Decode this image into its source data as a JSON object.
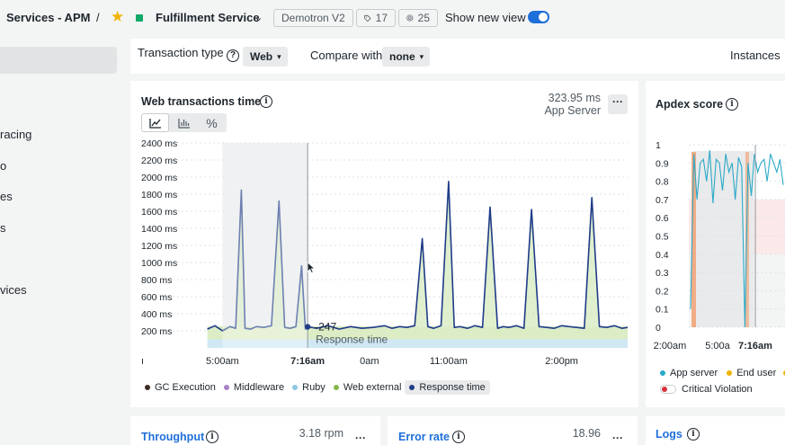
{
  "header": {
    "breadcrumb": "Services - APM",
    "separator": "/",
    "entity_name": "Fulfillment Service",
    "environment_tag": "Demotron V2",
    "tags_count": "17",
    "related_count": "25",
    "toggle_label": "Show new view",
    "toggle_on": true,
    "colors": {
      "favorite": "#f0b400",
      "health": "#11a968",
      "toggle": "#1e6fd9"
    }
  },
  "sidebar": {
    "items": [
      {
        "label": "racing"
      },
      {
        "label": "o"
      },
      {
        "label": "es"
      },
      {
        "label": "s"
      },
      {
        "label": "vices"
      }
    ]
  },
  "filters": {
    "transaction_type_label": "Transaction type",
    "transaction_type_value": "Web",
    "compare_label": "Compare with",
    "compare_value": "none",
    "instances_label": "Instances"
  },
  "web_transactions": {
    "title": "Web transactions time",
    "summary_value": "323.95 ms",
    "summary_label": "App Server",
    "tooltip_value": "247",
    "tooltip_label": "Response time",
    "legend": [
      {
        "label": "GC Execution",
        "color": "#3b2b22"
      },
      {
        "label": "Middleware",
        "color": "#a783c6"
      },
      {
        "label": "Ruby",
        "color": "#8ec6e6"
      },
      {
        "label": "Web external",
        "color": "#86b84a"
      },
      {
        "label": "Response time",
        "color": "#1f3c88"
      }
    ]
  },
  "apdex": {
    "title": "Apdex score",
    "legend": [
      {
        "label": "App server",
        "color": "#2aa9c9"
      },
      {
        "label": "End user",
        "color": "#f0b400"
      }
    ],
    "critical_label": "Critical Violation",
    "colors": {
      "critical": "#d8313a"
    }
  },
  "throughput": {
    "title": "Throughput",
    "value": "3.18",
    "unit": "rpm"
  },
  "error_rate": {
    "title": "Error rate",
    "value": "18.96"
  },
  "logs": {
    "title": "Logs"
  },
  "chart_data": [
    {
      "type": "area",
      "title": "Web transactions time",
      "ylim": [
        0,
        2400
      ],
      "y_ticks": [
        "2400 ms",
        "2200 ms",
        "2000 ms",
        "1800 ms",
        "1600 ms",
        "1400 ms",
        "1200 ms",
        "1000 ms",
        "800 ms",
        "600 ms",
        "400 ms",
        "200 ms"
      ],
      "x_ticks": [
        "5:00am",
        "7:16am",
        "0am",
        "11:00am",
        "2:00pm"
      ],
      "x_tick_left_edge": "ı",
      "x_range_hours": [
        3.75,
        15.75
      ],
      "selection_range_hours": [
        5.0,
        7.26
      ],
      "crosshair_hours": 7.26,
      "grid": true,
      "series": [
        {
          "name": "Response time",
          "color": "#1f3c88",
          "x_hours": [
            4.6,
            4.8,
            5.0,
            5.2,
            5.35,
            5.5,
            5.6,
            5.75,
            5.9,
            6.1,
            6.3,
            6.5,
            6.65,
            6.8,
            6.95,
            7.1,
            7.2,
            7.26,
            7.5,
            7.8,
            8.1,
            8.4,
            8.7,
            9.0,
            9.3,
            9.5,
            9.7,
            9.9,
            10.1,
            10.3,
            10.45,
            10.6,
            10.8,
            11.0,
            11.15,
            11.3,
            11.5,
            11.7,
            11.9,
            12.1,
            12.3,
            12.45,
            12.6,
            12.8,
            13.0,
            13.2,
            13.4,
            13.6,
            13.8,
            14.0,
            14.2,
            14.4,
            14.6,
            14.8,
            15.0,
            15.2,
            15.4,
            15.6,
            15.75
          ],
          "values": [
            220,
            260,
            200,
            250,
            230,
            1850,
            230,
            220,
            250,
            240,
            260,
            1720,
            240,
            230,
            250,
            960,
            220,
            247,
            230,
            260,
            220,
            250,
            230,
            240,
            260,
            230,
            250,
            240,
            260,
            1280,
            250,
            230,
            260,
            1950,
            240,
            250,
            230,
            260,
            240,
            1650,
            230,
            250,
            240,
            260,
            230,
            1620,
            250,
            240,
            230,
            260,
            250,
            240,
            230,
            1760,
            250,
            240,
            260,
            230,
            240
          ]
        },
        {
          "name": "Web external",
          "color": "#86b84a",
          "value_approx": 150
        },
        {
          "name": "Ruby",
          "color": "#8ec6e6",
          "value_approx": 100
        },
        {
          "name": "Middleware",
          "color": "#a783c6",
          "value_approx": 0
        },
        {
          "name": "GC Execution",
          "color": "#3b2b22",
          "value_approx": 0
        }
      ]
    },
    {
      "type": "line",
      "title": "Apdex score",
      "ylim": [
        0,
        1
      ],
      "y_ticks": [
        "1",
        "0.9",
        "0.8",
        "0.7",
        "0.6",
        "0.5",
        "0.4",
        "0.3",
        "0.2",
        "0.1",
        "0"
      ],
      "x_ticks": [
        "2:00am",
        "5:00a",
        "7:16am"
      ],
      "series": [
        {
          "name": "App server",
          "color": "#2aa9c9",
          "values": [
            0.1,
            0.95,
            0.7,
            0.9,
            0.92,
            0.8,
            0.97,
            0.68,
            0.92,
            0.9,
            0.75,
            0.95,
            0.85,
            0.9,
            0.7,
            0.93,
            0.88,
            0.0,
            0.9,
            0.72,
            0.95,
            0.85,
            0.9,
            0.92,
            0.8,
            0.95,
            0.9,
            0.85,
            0.92,
            0.78
          ]
        },
        {
          "name": "End user",
          "color": "#f0b400",
          "values": []
        }
      ]
    }
  ]
}
